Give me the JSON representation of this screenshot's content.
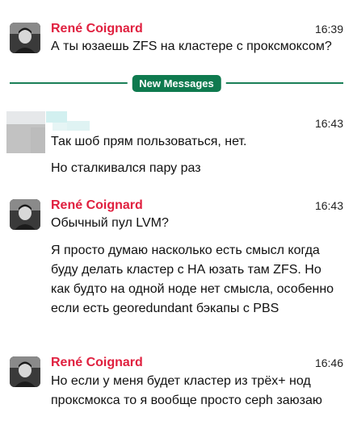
{
  "messages": [
    {
      "sender": "René Coignard",
      "time": "16:39",
      "lines": [
        "А ты юзаешь ZFS на кластере с проксмоксом?"
      ]
    },
    {
      "sender": "",
      "time": "16:43",
      "lines": [
        "Так шоб прям пользоваться, нет.",
        "Но сталкивался пару раз"
      ]
    },
    {
      "sender": "René Coignard",
      "time": "16:43",
      "lines": [
        "Обычный пул LVM?",
        "Я просто думаю насколько есть смысл когда буду делать кластер с НА юзать там ZFS. Но как будто на одной ноде нет смысла, особенно если есть georedundant бэкапы с PBS"
      ]
    },
    {
      "sender": "René Coignard",
      "time": "16:46",
      "lines": [
        "Но если у меня будет кластер из трёх+ нод проксмокса то я вообще просто ceph заюзаю"
      ]
    }
  ],
  "divider": {
    "label": "New Messages",
    "color": "#0f7a4f"
  },
  "colors": {
    "sender": "#e0203f",
    "accent": "#0f7a4f"
  }
}
